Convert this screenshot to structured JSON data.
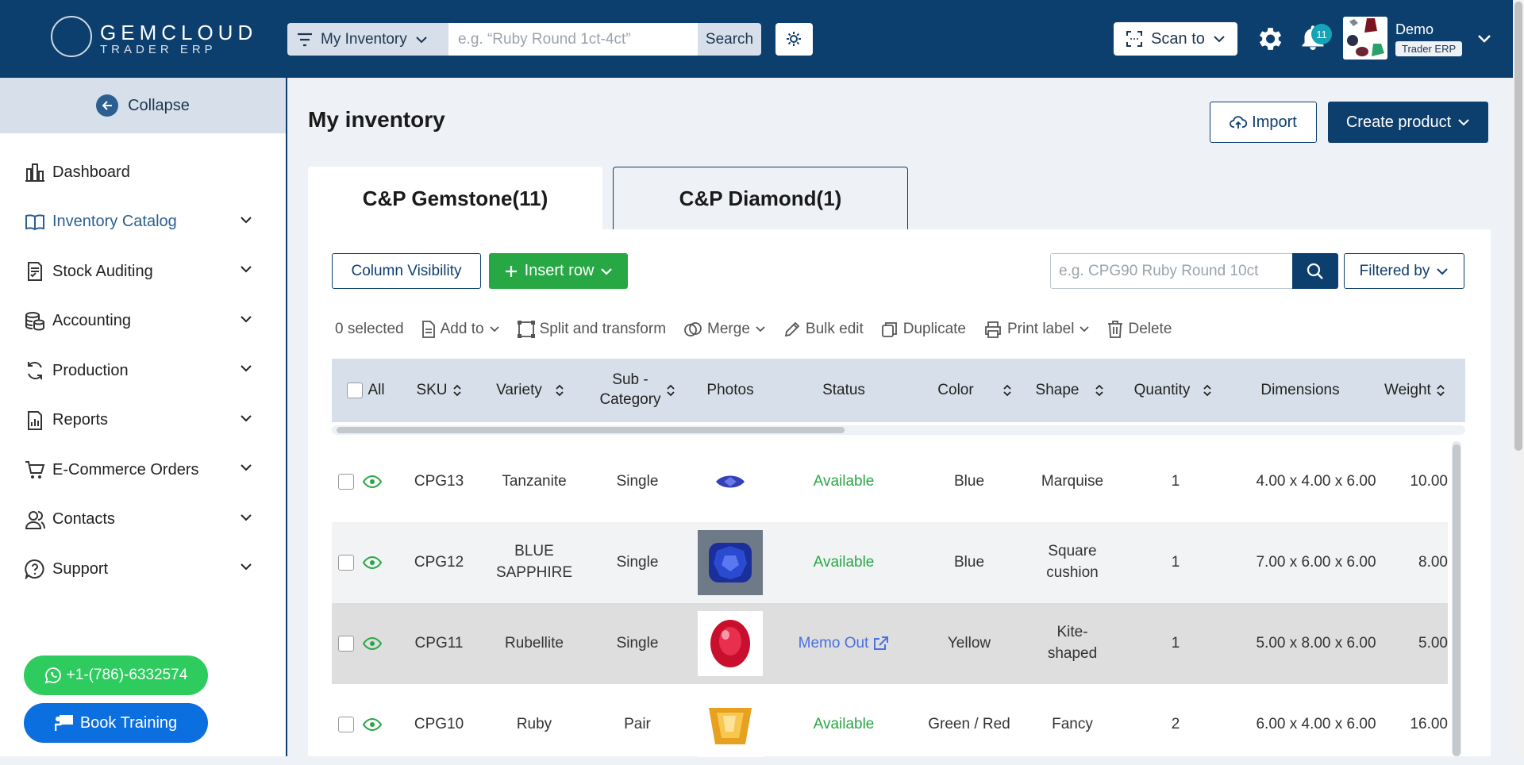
{
  "header": {
    "logo_name": "GEMCLOUD",
    "logo_sub": "TRADER ERP",
    "scope_label": "My Inventory",
    "search_placeholder": "e.g. “Ruby Round 1ct-4ct”",
    "search_button": "Search",
    "scan_label": "Scan to",
    "notification_count": "11",
    "user_name": "Demo",
    "user_role": "Trader ERP"
  },
  "sidebar": {
    "collapse_label": "Collapse",
    "items": [
      {
        "label": "Dashboard",
        "icon": "dashboard-icon",
        "expandable": false,
        "active": false
      },
      {
        "label": "Inventory Catalog",
        "icon": "book-icon",
        "expandable": true,
        "active": true
      },
      {
        "label": "Stock Auditing",
        "icon": "audit-icon",
        "expandable": true,
        "active": false
      },
      {
        "label": "Accounting",
        "icon": "coins-icon",
        "expandable": true,
        "active": false
      },
      {
        "label": "Production",
        "icon": "refresh-icon",
        "expandable": true,
        "active": false
      },
      {
        "label": "Reports",
        "icon": "report-icon",
        "expandable": true,
        "active": false
      },
      {
        "label": "E-Commerce Orders",
        "icon": "cart-icon",
        "expandable": true,
        "active": false
      },
      {
        "label": "Contacts",
        "icon": "contacts-icon",
        "expandable": true,
        "active": false
      },
      {
        "label": "Support",
        "icon": "support-icon",
        "expandable": true,
        "active": false
      }
    ],
    "phone": "+1-(786)-6332574",
    "training": "Book Training"
  },
  "main": {
    "title": "My inventory",
    "import_label": "Import",
    "create_label": "Create product",
    "tabs": [
      {
        "label": "C&P Gemstone(11)",
        "active": true
      },
      {
        "label": "C&P Diamond(1)",
        "active": false
      }
    ],
    "column_visibility": "Column Visibility",
    "insert_row": "Insert row",
    "table_search_placeholder": "e.g. CPG90 Ruby Round 10ct",
    "filtered_by": "Filtered by",
    "actions": {
      "selected": "0 selected",
      "add_to": "Add to",
      "split": "Split and transform",
      "merge": "Merge",
      "bulk_edit": "Bulk edit",
      "duplicate": "Duplicate",
      "print_label": "Print label",
      "delete": "Delete"
    },
    "columns": {
      "all": "All",
      "sku": "SKU",
      "variety": "Variety",
      "subcategory_1": "Sub -",
      "subcategory_2": "Category",
      "photos": "Photos",
      "status": "Status",
      "color": "Color",
      "shape": "Shape",
      "quantity": "Quantity",
      "dimensions": "Dimensions",
      "weight": "Weight"
    },
    "rows": [
      {
        "sku": "CPG13",
        "variety": "Tanzanite",
        "subcategory": "Single",
        "photo": "tanzanite-photo",
        "status": "Available",
        "color": "Blue",
        "shape": "Marquise",
        "quantity": "1",
        "dimensions": "4.00 x 4.00 x 6.00",
        "weight": "10.00"
      },
      {
        "sku": "CPG12",
        "variety": "BLUE SAPPHIRE",
        "subcategory": "Single",
        "photo": "sapphire-photo",
        "status": "Available",
        "color": "Blue",
        "shape": "Square cushion",
        "quantity": "1",
        "dimensions": "7.00 x 6.00 x 6.00",
        "weight": "8.00"
      },
      {
        "sku": "CPG11",
        "variety": "Rubellite",
        "subcategory": "Single",
        "photo": "rubellite-photo",
        "status": "Memo Out",
        "color": "Yellow",
        "shape": "Kite-shaped",
        "quantity": "1",
        "dimensions": "5.00 x 8.00 x 6.00",
        "weight": "5.00"
      },
      {
        "sku": "CPG10",
        "variety": "Ruby",
        "subcategory": "Pair",
        "photo": "ruby-photo",
        "status": "Available",
        "color": "Green / Red",
        "shape": "Fancy",
        "quantity": "2",
        "dimensions": "6.00 x 4.00 x 6.00",
        "weight": "16.00"
      }
    ]
  },
  "colors": {
    "brand": "#0d3f6e",
    "available": "#28a745",
    "memo": "#4a6fe0",
    "whatsapp": "#2ecc5f",
    "training": "#0b6fe0"
  }
}
